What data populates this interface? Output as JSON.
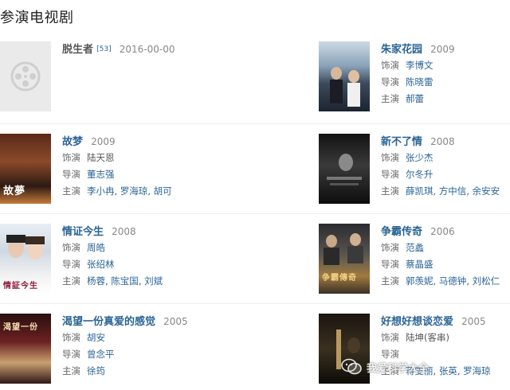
{
  "section_title": "参演电视剧",
  "labels": {
    "role": "饰演",
    "director": "导演",
    "cast": "主演"
  },
  "watermark_text": "我爱科学大全",
  "dramas": [
    {
      "title": "脱生者",
      "badge": "[53]",
      "year": "2016-00-00",
      "role": "",
      "director": "",
      "cast": [],
      "poster": "placeholder-film-reel-icon"
    },
    {
      "title": "朱家花园",
      "year": "2009",
      "role": "李博文",
      "director": "陈晓雷",
      "cast": [
        "郝蕾"
      ]
    },
    {
      "title": "故梦",
      "year": "2009",
      "role": "陆天恩",
      "director": "董志强",
      "cast": [
        "李小冉",
        "罗海琼",
        "胡可"
      ]
    },
    {
      "title": "新不了情",
      "year": "2008",
      "role": "张少杰",
      "director": "尔冬升",
      "cast": [
        "薛凯琪",
        "方中信",
        "余安安"
      ]
    },
    {
      "title": "情证今生",
      "year": "2008",
      "role": "周皓",
      "director": "张绍林",
      "cast": [
        "杨蓉",
        "陈宝国",
        "刘斌"
      ]
    },
    {
      "title": "争霸传奇",
      "year": "2006",
      "role": "范蠡",
      "director": "蔡晶盛",
      "cast": [
        "郭羡妮",
        "马德钟",
        "刘松仁"
      ]
    },
    {
      "title": "渴望一份真爱的感觉",
      "year": "2005",
      "role": "胡安",
      "director": "曾念平",
      "cast": [
        "徐筠"
      ]
    },
    {
      "title": "好想好想谈恋爱",
      "year": "2005",
      "role": "陆坤(客串)",
      "director": "",
      "cast": [
        "蒋雯丽",
        "张英",
        "罗海琼"
      ]
    }
  ],
  "poster_texts": {
    "p2": "故夢",
    "p4": "情証今生",
    "p5": "争霸傳奇",
    "p6": "渴望一份"
  }
}
